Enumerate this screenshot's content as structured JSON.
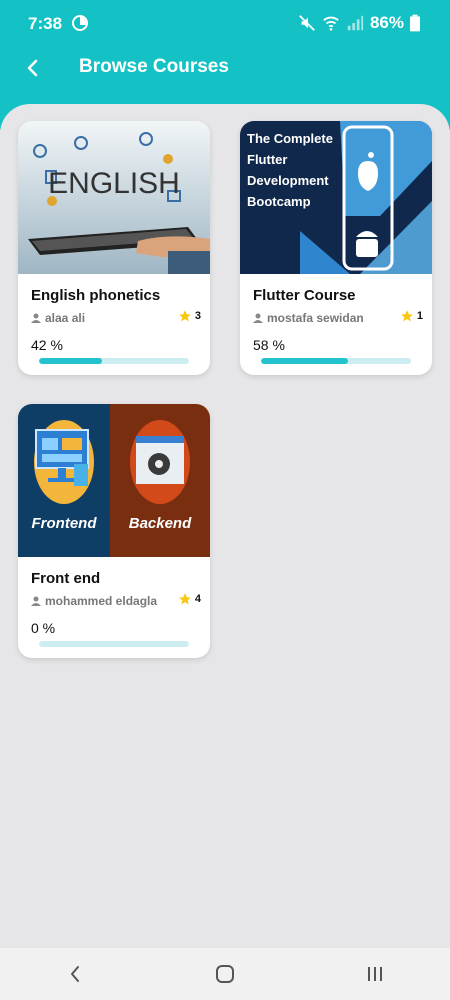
{
  "status_bar": {
    "time": "7:38",
    "battery": "86%"
  },
  "appbar": {
    "title": "Browse Courses",
    "accent": "#14c2c5"
  },
  "courses": [
    {
      "title": "English phonetics",
      "author": "alaa ali",
      "rating": "3",
      "progress_label": "42 %",
      "progress": 0.42,
      "thumbnail": {
        "word": "ENGLISH"
      }
    },
    {
      "title": "Flutter Course",
      "author": "mostafa sewidan",
      "rating": "1",
      "progress_label": "58 %",
      "progress": 0.58,
      "thumbnail": {
        "lines": [
          "The Complete",
          "Flutter",
          "Development",
          "Bootcamp"
        ]
      }
    },
    {
      "title": "Front end",
      "author": "mohammed eldagla",
      "rating": "4",
      "progress_label": "0 %",
      "progress": 0.0,
      "thumbnail": {
        "left_label": "Frontend",
        "right_label": "Backend"
      }
    }
  ]
}
